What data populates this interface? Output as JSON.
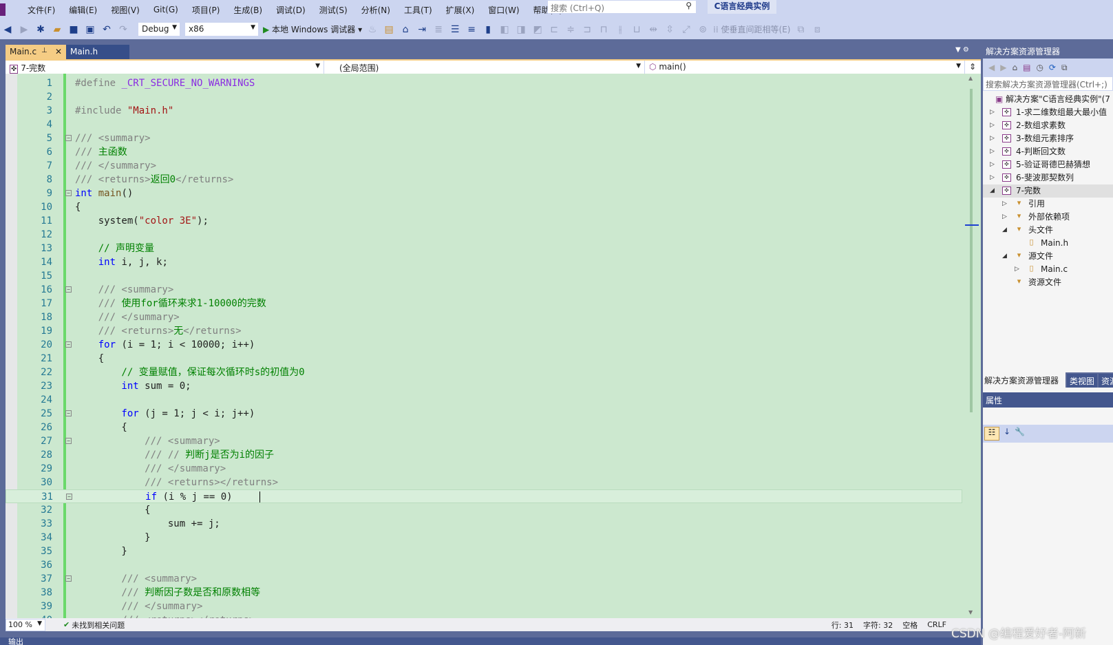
{
  "menu": [
    "文件(F)",
    "编辑(E)",
    "视图(V)",
    "Git(G)",
    "项目(P)",
    "生成(B)",
    "调试(D)",
    "测试(S)",
    "分析(N)",
    "工具(T)",
    "扩展(X)",
    "窗口(W)",
    "帮助(H)"
  ],
  "search": {
    "placeholder": "搜索 (Ctrl+Q)"
  },
  "solution_name": "C语言经典实例",
  "toolbar": {
    "config": "Debug",
    "platform": "x86",
    "run_label": "本地 Windows 调试器",
    "spacing_label": "使垂直间距相等(E)"
  },
  "tabs": [
    {
      "label": "Main.c",
      "active": true
    },
    {
      "label": "Main.h",
      "active": false
    }
  ],
  "nav": {
    "project": "7-完数",
    "scope": "(全局范围)",
    "member": "main()"
  },
  "code": [
    [
      [
        "#define ",
        "pp"
      ],
      [
        "_CRT_SECURE_NO_WARNINGS",
        "mac"
      ]
    ],
    [],
    [
      [
        "#include ",
        "pp"
      ],
      [
        "\"Main.h\"",
        "str"
      ]
    ],
    [],
    [
      [
        "/// <summary>",
        "dc"
      ]
    ],
    [
      [
        "/// ",
        "dc"
      ],
      [
        "主函数",
        "c"
      ]
    ],
    [
      [
        "/// </summary>",
        "dc"
      ]
    ],
    [
      [
        "/// <returns>",
        "dc"
      ],
      [
        "返回0",
        "c"
      ],
      [
        "</returns>",
        "dc"
      ]
    ],
    [
      [
        "int",
        "k"
      ],
      [
        " main",
        "fn"
      ],
      [
        "()",
        "t"
      ]
    ],
    [
      [
        "{",
        "t"
      ]
    ],
    [
      [
        "    system(",
        "t"
      ],
      [
        "\"color 3E\"",
        "str"
      ],
      [
        ");",
        "t"
      ]
    ],
    [],
    [
      [
        "    // 声明变量",
        "c"
      ]
    ],
    [
      [
        "    int",
        "k"
      ],
      [
        " i, j, k;",
        "t"
      ]
    ],
    [],
    [
      [
        "    /// <summary>",
        "dc"
      ]
    ],
    [
      [
        "    /// ",
        "dc"
      ],
      [
        "使用for循环来求1-10000的完数",
        "c"
      ]
    ],
    [
      [
        "    /// </summary>",
        "dc"
      ]
    ],
    [
      [
        "    /// <returns>",
        "dc"
      ],
      [
        "无",
        "c"
      ],
      [
        "</returns>",
        "dc"
      ]
    ],
    [
      [
        "    for",
        "k"
      ],
      [
        " (i = 1; i < 10000; i++)",
        "t"
      ]
    ],
    [
      [
        "    {",
        "t"
      ]
    ],
    [
      [
        "        // 变量赋值，保证每次循环时s的初值为0",
        "c"
      ]
    ],
    [
      [
        "        int",
        "k"
      ],
      [
        " sum = 0;",
        "t"
      ]
    ],
    [],
    [
      [
        "        for",
        "k"
      ],
      [
        " (j = 1; j < i; j++)",
        "t"
      ]
    ],
    [
      [
        "        {",
        "t"
      ]
    ],
    [
      [
        "            /// <summary>",
        "dc"
      ]
    ],
    [
      [
        "            /// // ",
        "dc"
      ],
      [
        "判断j是否为i的因子",
        "c"
      ]
    ],
    [
      [
        "            /// </summary>",
        "dc"
      ]
    ],
    [
      [
        "            /// <returns></returns>",
        "dc"
      ]
    ],
    [
      [
        "            if",
        "k"
      ],
      [
        " (i % j == 0)",
        "t"
      ]
    ],
    [
      [
        "            {",
        "t"
      ]
    ],
    [
      [
        "                sum += j;",
        "t"
      ]
    ],
    [
      [
        "            }",
        "t"
      ]
    ],
    [
      [
        "        }",
        "t"
      ]
    ],
    [],
    [
      [
        "        /// <summary>",
        "dc"
      ]
    ],
    [
      [
        "        /// ",
        "dc"
      ],
      [
        "判断因子数是否和原数相等",
        "c"
      ]
    ],
    [
      [
        "        /// </summary>",
        "dc"
      ]
    ],
    [
      [
        "        /// <returns></returns>",
        "dc"
      ]
    ]
  ],
  "folds": [
    5,
    9,
    16,
    20,
    25,
    27,
    31,
    37
  ],
  "current_line": 31,
  "status": {
    "zoom": "100 %",
    "issues": "未找到相关问题",
    "line": "行: 31",
    "char": "字符: 32",
    "spaces": "空格",
    "eol": "CRLF"
  },
  "output_title": "输出",
  "solution_explorer": {
    "title": "解决方案资源管理器",
    "search_placeholder": "搜索解决方案资源管理器(Ctrl+;)",
    "root": "解决方案\"C语言经典实例\"(7",
    "items": [
      {
        "label": "1-求二维数组最大最小值",
        "depth": 0,
        "arrow": "▷"
      },
      {
        "label": "2-数组求素数",
        "depth": 0,
        "arrow": "▷"
      },
      {
        "label": "3-数组元素排序",
        "depth": 0,
        "arrow": "▷"
      },
      {
        "label": "4-判断回文数",
        "depth": 0,
        "arrow": "▷"
      },
      {
        "label": "5-验证哥德巴赫猜想",
        "depth": 0,
        "arrow": "▷"
      },
      {
        "label": "6-斐波那契数列",
        "depth": 0,
        "arrow": "▷"
      },
      {
        "label": "7-完数",
        "depth": 0,
        "arrow": "◢",
        "selected": true
      },
      {
        "label": "引用",
        "depth": 1,
        "arrow": "▷"
      },
      {
        "label": "外部依赖项",
        "depth": 1,
        "arrow": "▷"
      },
      {
        "label": "头文件",
        "depth": 1,
        "arrow": "◢"
      },
      {
        "label": "Main.h",
        "depth": 2,
        "arrow": ""
      },
      {
        "label": "源文件",
        "depth": 1,
        "arrow": "◢"
      },
      {
        "label": "Main.c",
        "depth": 2,
        "arrow": "▷"
      },
      {
        "label": "资源文件",
        "depth": 1,
        "arrow": ""
      }
    ],
    "tabs": [
      "解决方案资源管理器",
      "类视图",
      "资源"
    ]
  },
  "properties": {
    "title": "属性"
  },
  "watermark": "CSDN @编程爱好者-阿新"
}
